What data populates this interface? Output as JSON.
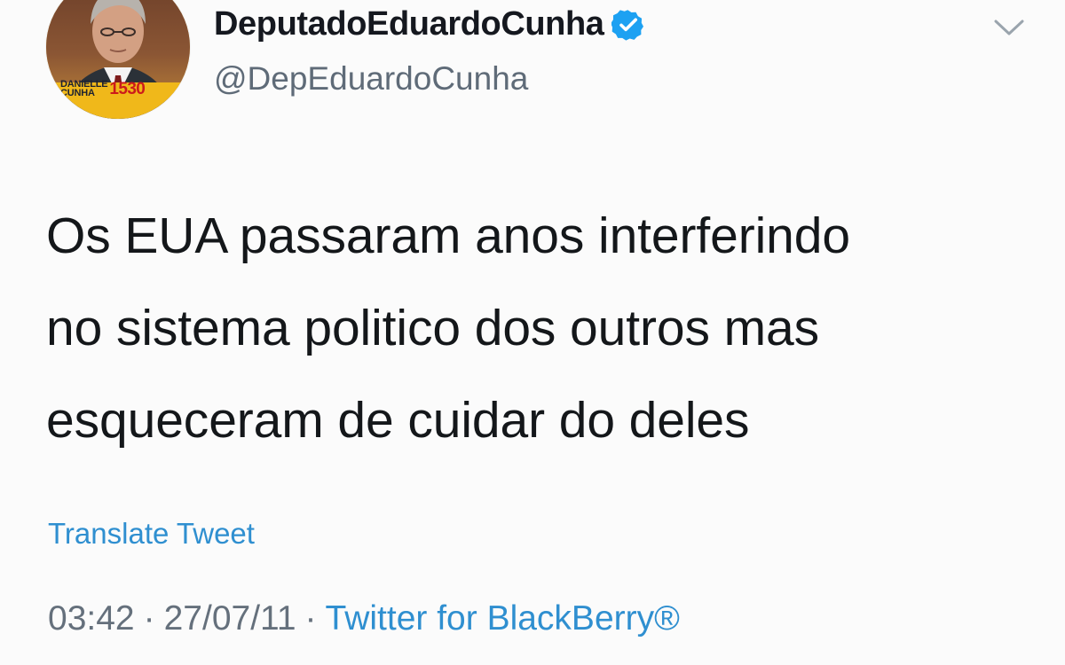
{
  "tweet": {
    "author": {
      "display_name": "DeputadoEduardoCunha",
      "handle": "@DepEduardoCunha",
      "verified_icon": "verified-icon",
      "avatar": {
        "badge_name_line1": "DANIELLE",
        "badge_name_line2": "CUNHA",
        "badge_number": "1530"
      }
    },
    "text_lines": [
      "Os EUA passaram anos interferindo",
      "no sistema politico dos outros mas",
      "esqueceram de cuidar do deles"
    ],
    "translate_label": "Translate Tweet",
    "meta": {
      "time": "03:42",
      "date": "27/07/11",
      "source": "Twitter for BlackBerry®",
      "separator": "·"
    }
  },
  "colors": {
    "background": "#fbfbfb",
    "text": "#14171a",
    "muted": "#5f6b78",
    "link": "#2f8fd0",
    "verified": "#1da1f2"
  }
}
